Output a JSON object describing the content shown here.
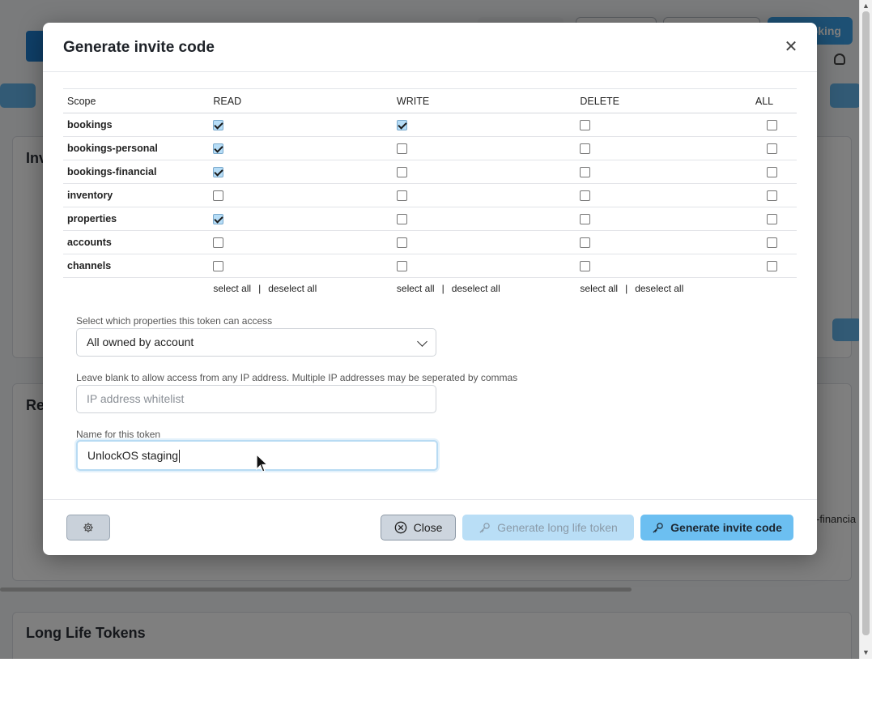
{
  "background": {
    "booking_button_label": "oking",
    "section_1_title": "Inv",
    "section_2_title": "Re",
    "section_3_title": "Long Life Tokens",
    "peek_text": "-financia"
  },
  "modal": {
    "title": "Generate invite code",
    "close_icon": "close-icon",
    "table": {
      "headers": [
        "Scope",
        "READ",
        "WRITE",
        "DELETE",
        "ALL"
      ],
      "rows": [
        {
          "scope": "bookings",
          "read": true,
          "write": true,
          "delete": false,
          "all": false
        },
        {
          "scope": "bookings-personal",
          "read": true,
          "write": false,
          "delete": false,
          "all": false
        },
        {
          "scope": "bookings-financial",
          "read": true,
          "write": false,
          "delete": false,
          "all": false
        },
        {
          "scope": "inventory",
          "read": false,
          "write": false,
          "delete": false,
          "all": false
        },
        {
          "scope": "properties",
          "read": true,
          "write": false,
          "delete": false,
          "all": false
        },
        {
          "scope": "accounts",
          "read": false,
          "write": false,
          "delete": false,
          "all": false
        },
        {
          "scope": "channels",
          "read": false,
          "write": false,
          "delete": false,
          "all": false
        }
      ],
      "select_all": "select all",
      "separator": "|",
      "deselect_all": "deselect all"
    },
    "properties_field": {
      "label": "Select which properties this token can access",
      "value": "All owned by account"
    },
    "ip_field": {
      "label": "Leave blank to allow access from any IP address. Multiple IP addresses may be seperated by commas",
      "placeholder": "IP address whitelist"
    },
    "name_field": {
      "label": "Name for this token",
      "value": "UnlockOS staging"
    },
    "footer": {
      "settings_icon": "gear-icon",
      "close_label": "Close",
      "long_life_label": "Generate long life token",
      "invite_label": "Generate invite code"
    }
  },
  "colors": {
    "primary": "#6cbff1",
    "primary_disabled": "#b9def6",
    "secondary": "#cdd5de",
    "checkbox_checked": "#b6ddf7"
  }
}
